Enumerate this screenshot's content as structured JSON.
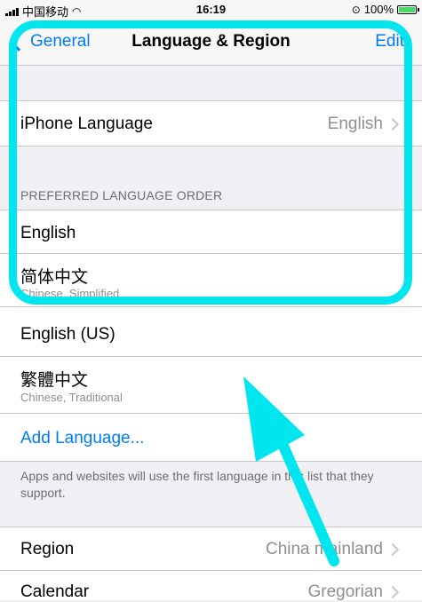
{
  "status_bar": {
    "carrier": "中国移动",
    "time": "16:19",
    "battery": "100%"
  },
  "nav": {
    "back_label": "General",
    "title": "Language & Region",
    "edit_label": "Edit"
  },
  "iphone_language": {
    "label": "iPhone Language",
    "value": "English"
  },
  "preferred": {
    "header": "PREFERRED LANGUAGE ORDER",
    "items": [
      {
        "title": "English",
        "subtitle": ""
      },
      {
        "title": "简体中文",
        "subtitle": "Chinese, Simplified"
      },
      {
        "title": "English (US)",
        "subtitle": ""
      },
      {
        "title": "繁體中文",
        "subtitle": "Chinese, Traditional"
      }
    ],
    "add_label": "Add Language...",
    "footer": "Apps and websites will use the first language in this list that they support."
  },
  "region": {
    "label": "Region",
    "value": "China mainland"
  },
  "calendar": {
    "label": "Calendar",
    "value": "Gregorian"
  },
  "colors": {
    "accent": "#007aff",
    "annotation": "#00e5ee",
    "background": "#efeff4"
  }
}
